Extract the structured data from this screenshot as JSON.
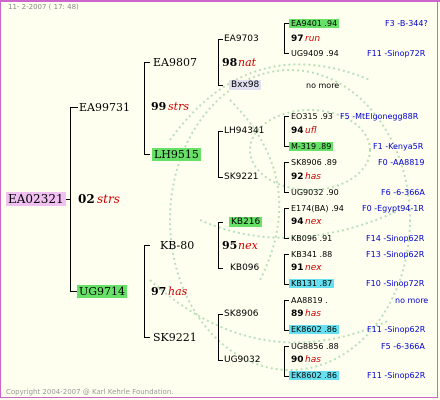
{
  "header": {
    "date_stamp": "11- 2-2007 ( 17: 48)"
  },
  "footer": {
    "copyright": "Copyright 2004-2007 @ Karl Kehrle Foundation."
  },
  "colors": {
    "border": "#cc66cc",
    "highlight_green": "#66e066",
    "highlight_cyan": "#66e0f0",
    "highlight_pink": "#f0c0f0",
    "code_red": "#cc0000",
    "blue_text": "#0000cc"
  },
  "gen1": {
    "id": "EA02321",
    "num": "02",
    "code": "strs"
  },
  "gen2": [
    {
      "id": "EA99731",
      "num": "99",
      "code": "strs"
    },
    {
      "id": "UG9714",
      "num": "97",
      "code": "has"
    }
  ],
  "gen3": [
    {
      "id": "EA9807",
      "num": "98",
      "code": "nat"
    },
    {
      "id": "LH9515"
    },
    {
      "id": "KB-80",
      "num": "95",
      "code": "nex"
    },
    {
      "id": "SK9221"
    }
  ],
  "gen4": [
    {
      "id": "EA9703",
      "num": "97",
      "code": "run"
    },
    {
      "id": "Bxx98"
    },
    {
      "id": "LH94341",
      "num": "94",
      "code": "ufl"
    },
    {
      "id": "SK9221",
      "num": "92",
      "code": "has"
    },
    {
      "id": "KB216",
      "num": "94",
      "code": "nex"
    },
    {
      "id": "KB096",
      "num": "91",
      "code": "nex"
    },
    {
      "id": "SK8906",
      "num": "89",
      "code": "has"
    },
    {
      "id": "UG9032",
      "num": "90",
      "code": "has"
    }
  ],
  "gen5": [
    {
      "id": "EA9401 .94",
      "origin": "F3 -B-344?"
    },
    {
      "id": "UG9409 .94",
      "origin": "F11 -Sinop72R"
    },
    {
      "id": "",
      "origin": "no more"
    },
    {
      "id": "EO315 .93",
      "origin": "F5 -MtElgonegg88R"
    },
    {
      "id": "M-319 .89",
      "origin": "F1 -Kenya5R"
    },
    {
      "id": "SK8906 .89",
      "origin": "F0 -AA8819"
    },
    {
      "id": "UG9032 .90",
      "origin": "F6 -6-366A"
    },
    {
      "id": "E174(BA) .94",
      "origin": "F0 -Egypt94-1R"
    },
    {
      "id": "KB096 .91",
      "origin": "F14 -Sinop62R"
    },
    {
      "id": "KB341 .88",
      "origin": "F13 -Sinop62R"
    },
    {
      "id": "KB131 .87",
      "origin": "F10 -Sinop72R"
    },
    {
      "id": "AA8819 .",
      "origin": "no more"
    },
    {
      "id": "EK8602 .86",
      "origin": "F11 -Sinop62R"
    },
    {
      "id": "UG8856 .88",
      "origin": "F5 -6-366A"
    },
    {
      "id": "EK8602 .86",
      "origin": "F11 -Sinop62R"
    }
  ]
}
